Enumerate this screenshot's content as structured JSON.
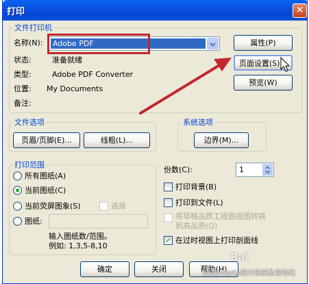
{
  "title": "打印",
  "close_glyph": "✕",
  "file_printer": {
    "group_title": "文件打印机",
    "name_label": "名称(N):",
    "name_value": "Adobe PDF",
    "status_label": "状态:",
    "status_value": "准备就绪",
    "type_label": "类型:",
    "type_value": "Adobe PDF Converter",
    "location_label": "位置:",
    "location_value": "My Documents",
    "comment_label": "备注:",
    "properties_button": "属性(P)",
    "page_setup_button": "页面设置(S)...",
    "preview_button": "预览(W)"
  },
  "file_options": {
    "group_title": "文件选项",
    "header_footer_button": "页眉/页脚(E)...",
    "line_weight_button": "线粗(L)..."
  },
  "system_options": {
    "group_title": "系统选项",
    "margins_button": "边界(M)..."
  },
  "print_range": {
    "group_title": "打印范围",
    "all_sheets": "所有图纸(A)",
    "current_sheet": "当前图纸(C)",
    "current_screen": "当前荧屏图象(S)",
    "select_label": "选择",
    "sheets_label": "图纸:",
    "sheets_value": "",
    "hint_line1": "输入图纸数/范围。",
    "hint_line2": "例如: 1,3,5-8,10",
    "selected": "current_sheet"
  },
  "copies": {
    "label": "份数(C):",
    "value": "1"
  },
  "options": {
    "print_background": "打印背景(B)",
    "print_to_file": "打印到文件(L)",
    "draft_to_high_line1": "将草稿品质工程图视图转换",
    "draft_to_high_line2": "到高品质(Q)",
    "print_cross_hatch": "在过时视图上打印剖面线"
  },
  "footer": {
    "ok_button": "确定",
    "close_button": "关闭",
    "help_button": "帮助(H)"
  },
  "watermark": {
    "text": "SolidWorks设计机械及自动化",
    "baidu": "Bai"
  },
  "colors": {
    "title_bar": "#0a56e3",
    "highlight_box": "#c0282d",
    "arrow": "#c0282d",
    "selection": "#316ac5"
  }
}
